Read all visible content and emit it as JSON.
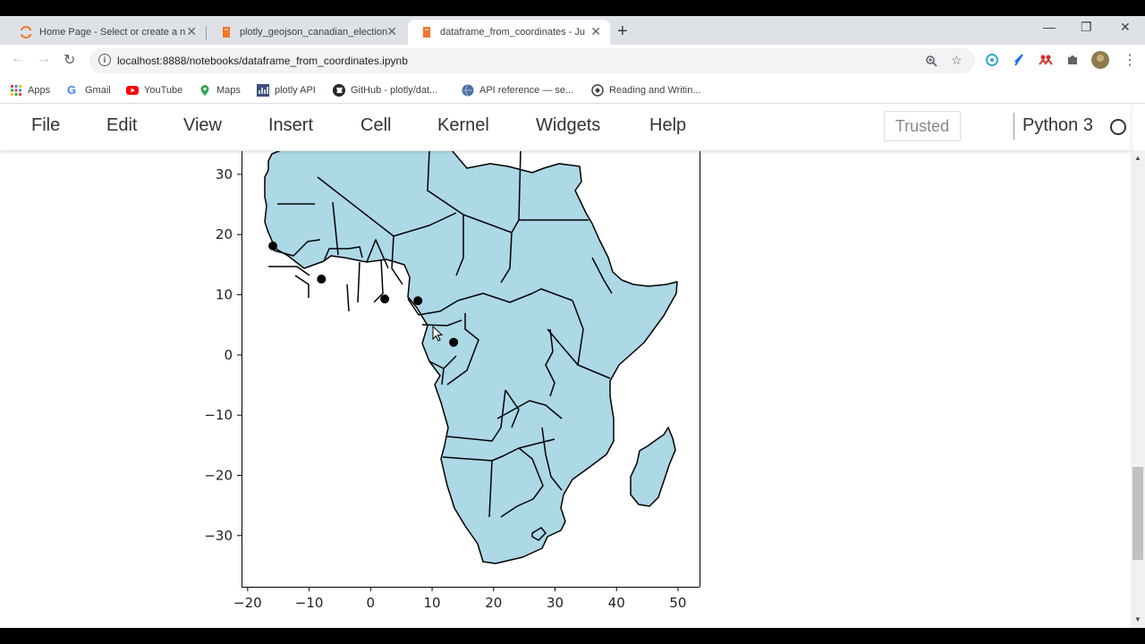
{
  "browser": {
    "tabs": [
      {
        "title": "Home Page - Select or create a n",
        "close": "✕"
      },
      {
        "title": "plotly_geojson_canadian_election",
        "close": "✕"
      },
      {
        "title": "dataframe_from_coordinates - Ju",
        "close": "✕"
      }
    ],
    "new_tab": "+",
    "window_controls": {
      "minimize": "—",
      "restore": "❐",
      "close": "✕"
    },
    "url": "localhost:8888/notebooks/dataframe_from_coordinates.ipynb",
    "bookmarks": [
      "Apps",
      "Gmail",
      "YouTube",
      "Maps",
      "plotly API",
      "GitHub - plotly/dat...",
      "API reference — se...",
      "Reading and Writin..."
    ]
  },
  "jupyter": {
    "menu": [
      "File",
      "Edit",
      "View",
      "Insert",
      "Cell",
      "Kernel",
      "Widgets",
      "Help"
    ],
    "trusted": "Trusted",
    "kernel": "Python 3"
  },
  "chart_data": {
    "type": "scatter",
    "xlabel": "",
    "ylabel": "",
    "xticks": [
      "−20",
      "−10",
      "0",
      "10",
      "20",
      "30",
      "40",
      "50"
    ],
    "yticks": [
      "30",
      "20",
      "10",
      "0",
      "−10",
      "−20",
      "−30"
    ],
    "xlim": [
      -21,
      53.5
    ],
    "ylim": [
      -38.5,
      34
    ],
    "land_color": "#add8e6",
    "points": [
      {
        "x": -15.9,
        "y": 18.1
      },
      {
        "x": -8.0,
        "y": 12.6
      },
      {
        "x": 2.3,
        "y": 9.3
      },
      {
        "x": 7.7,
        "y": 9.0
      },
      {
        "x": 13.5,
        "y": 2.1
      }
    ]
  }
}
